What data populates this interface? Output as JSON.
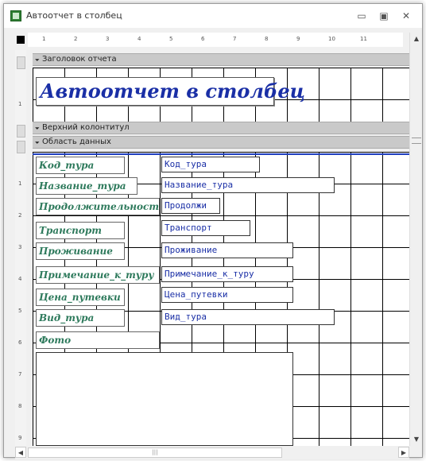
{
  "window": {
    "title": "Автоотчет в столбец",
    "minimize_glyph": "▭",
    "maximize_glyph": "▣",
    "close_glyph": "✕"
  },
  "ruler": {
    "h_marks": [
      "1",
      "2",
      "3",
      "4",
      "5",
      "6",
      "7",
      "8",
      "9",
      "10",
      "11"
    ],
    "v_marks": [
      "1",
      "2",
      "3",
      "4",
      "5",
      "6",
      "7",
      "8",
      "9"
    ]
  },
  "sections": {
    "report_header": "Заголовок отчета",
    "page_header": "Верхний колонтитул",
    "detail": "Область данных"
  },
  "report_title": "Автоотчет в столбец",
  "fields": [
    {
      "label": "Код_тура",
      "control": "Код_тура"
    },
    {
      "label": "Название_тура",
      "control": "Название_тура"
    },
    {
      "label": "Продолжительность",
      "control": "Продолжи"
    },
    {
      "label": "Транспорт",
      "control": "Транспорт"
    },
    {
      "label": "Проживание",
      "control": "Проживание"
    },
    {
      "label": "Примечание_к_туру",
      "control": "Примечание_к_туру"
    },
    {
      "label": "Цена_путевки",
      "control": "Цена_путевки"
    },
    {
      "label": "Вид_тура",
      "control": "Вид_тура"
    }
  ],
  "photo_label": "Фото",
  "icons": {
    "section_arrow": "🞃",
    "scroll_up": "▲",
    "scroll_down": "▼",
    "scroll_left": "◀",
    "scroll_right": "▶",
    "thumb_grip": "|||"
  }
}
